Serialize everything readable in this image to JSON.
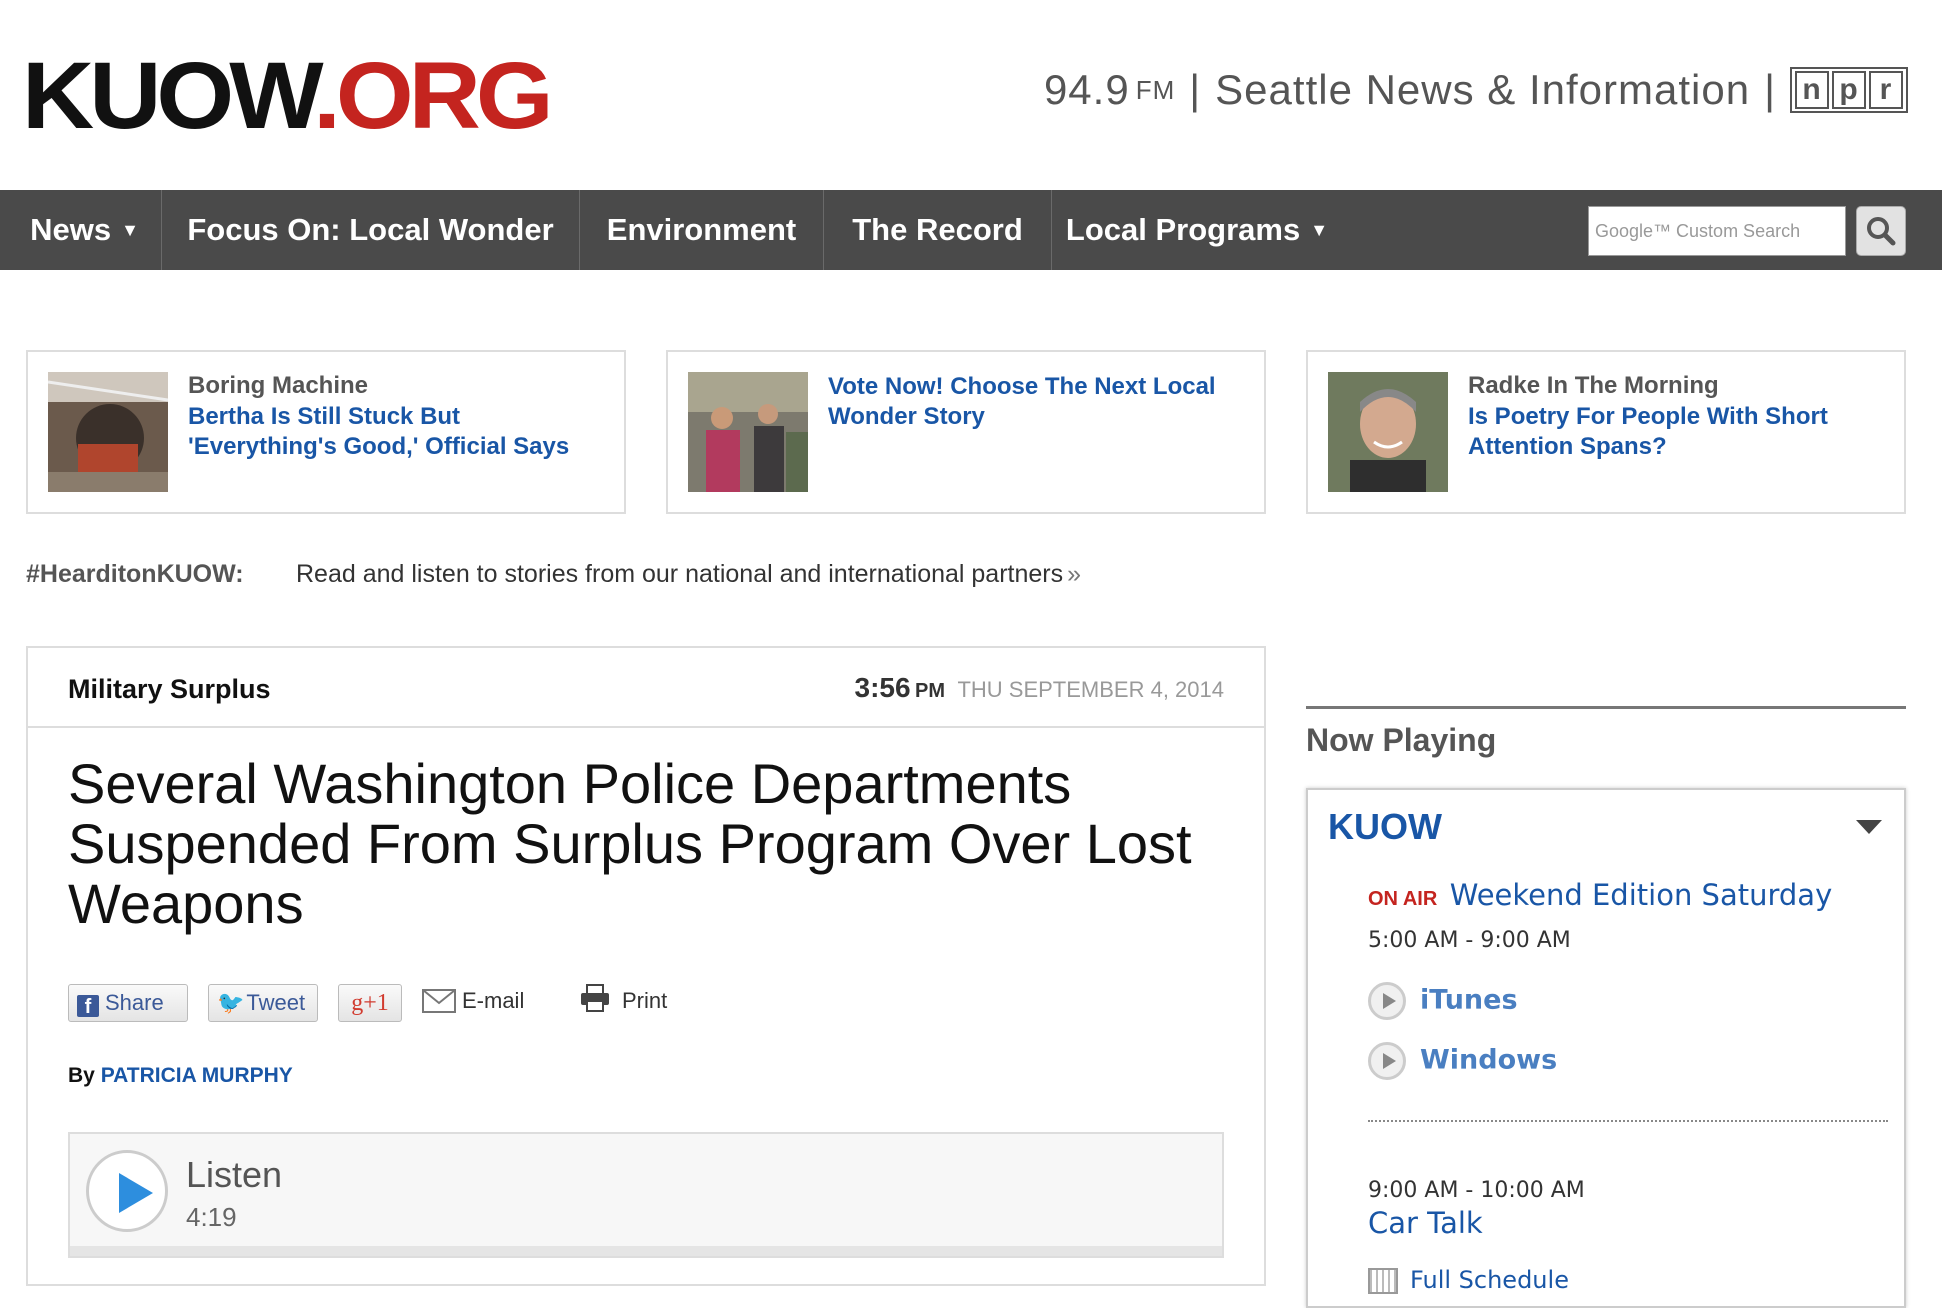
{
  "header": {
    "logo_main": "KUOW",
    "logo_ext": ".ORG",
    "frequency": "94.9",
    "band": "FM",
    "separator": "|",
    "tagline": "Seattle News & Information",
    "npr_letters": [
      "n",
      "p",
      "r"
    ]
  },
  "nav": {
    "items": [
      {
        "label": "News",
        "dropdown": true
      },
      {
        "label": "Focus On: Local Wonder",
        "dropdown": false
      },
      {
        "label": "Environment",
        "dropdown": false
      },
      {
        "label": "The Record",
        "dropdown": false
      },
      {
        "label": "Local Programs",
        "dropdown": true
      }
    ],
    "search_placeholder": "Google™ Custom Search",
    "search_icon": "magnifier-icon"
  },
  "featured": [
    {
      "kicker": "Boring Machine",
      "headline": "Bertha Is Still Stuck But 'Everything's Good,' Official Says",
      "image": "tunnel-construction-photo"
    },
    {
      "kicker": "",
      "headline": "Vote Now! Choose The Next Local Wonder Story",
      "image": "crowd-photo"
    },
    {
      "kicker": "Radke In The Morning",
      "headline": "Is Poetry For People With Short Attention Spans?",
      "image": "portrait-photo"
    }
  ],
  "heard_it": {
    "label": "#HearditonKUOW:",
    "text": "Read and listen to stories from our national and international partners",
    "arrow": "»"
  },
  "article": {
    "category": "Military Surplus",
    "time": "3:56",
    "ampm": "PM",
    "date": "THU SEPTEMBER 4, 2014",
    "title": "Several Washington Police Departments Suspended From Surplus Program Over Lost Weapons",
    "share": {
      "facebook": "Share",
      "twitter": "Tweet",
      "gplus": "g+1",
      "email": "E-mail",
      "print": "Print"
    },
    "by_label": "By",
    "author": "PATRICIA MURPHY",
    "player": {
      "label": "Listen",
      "duration": "4:19"
    }
  },
  "now_playing": {
    "heading": "Now Playing",
    "station": "KUOW",
    "on_air_badge": "ON AIR",
    "current_show": "Weekend Edition Saturday",
    "current_time": "5:00 AM - 9:00 AM",
    "streams": [
      "iTunes",
      "Windows"
    ],
    "next_time": "9:00 AM - 10:00 AM",
    "next_show": "Car Talk",
    "full_schedule": "Full Schedule"
  },
  "colors": {
    "brand_red": "#c4241f",
    "link_blue": "#1956a6",
    "nav_bg": "#4a4a4a"
  }
}
